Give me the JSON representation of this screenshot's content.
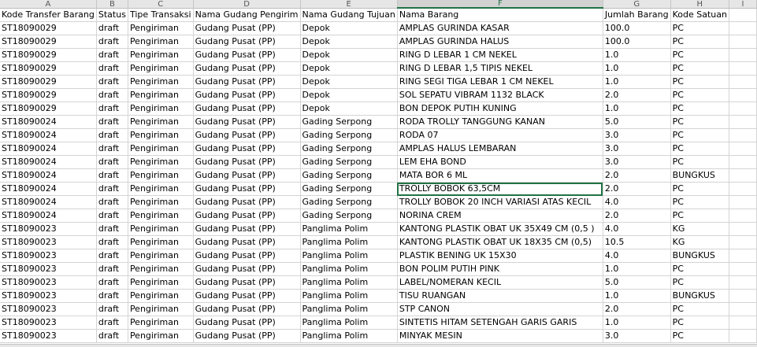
{
  "columns": [
    "A",
    "B",
    "C",
    "D",
    "E",
    "F",
    "G",
    "H",
    "I"
  ],
  "selected_column": "F",
  "headers": [
    "Kode Transfer Barang",
    "Status",
    "Tipe Transaksi",
    "Nama Gudang Pengirim",
    "Nama Gudang Tujuan",
    "Nama Barang",
    "Jumlah Barang",
    "Kode Satuan",
    ""
  ],
  "rows": [
    [
      "ST18090029",
      "draft",
      "Pengiriman",
      "Gudang Pusat (PP)",
      "Depok",
      "AMPLAS GURINDA KASAR",
      "100.0",
      "PC",
      ""
    ],
    [
      "ST18090029",
      "draft",
      "Pengiriman",
      "Gudang Pusat (PP)",
      "Depok",
      "AMPLAS GURINDA HALUS",
      "100.0",
      "PC",
      ""
    ],
    [
      "ST18090029",
      "draft",
      "Pengiriman",
      "Gudang Pusat (PP)",
      "Depok",
      "RING D LEBAR 1 CM NEKEL",
      "1.0",
      "PC",
      ""
    ],
    [
      "ST18090029",
      "draft",
      "Pengiriman",
      "Gudang Pusat (PP)",
      "Depok",
      "RING D LEBAR 1,5 TIPIS NEKEL",
      "1.0",
      "PC",
      ""
    ],
    [
      "ST18090029",
      "draft",
      "Pengiriman",
      "Gudang Pusat (PP)",
      "Depok",
      "RING SEGI TIGA LEBAR 1 CM NEKEL",
      "1.0",
      "PC",
      ""
    ],
    [
      "ST18090029",
      "draft",
      "Pengiriman",
      "Gudang Pusat (PP)",
      "Depok",
      "SOL SEPATU VIBRAM 1132 BLACK",
      "2.0",
      "PC",
      ""
    ],
    [
      "ST18090029",
      "draft",
      "Pengiriman",
      "Gudang Pusat (PP)",
      "Depok",
      "BON DEPOK PUTIH KUNING",
      "1.0",
      "PC",
      ""
    ],
    [
      "ST18090024",
      "draft",
      "Pengiriman",
      "Gudang Pusat (PP)",
      "Gading Serpong",
      "RODA TROLLY TANGGUNG KANAN",
      "5.0",
      "PC",
      ""
    ],
    [
      "ST18090024",
      "draft",
      "Pengiriman",
      "Gudang Pusat (PP)",
      "Gading Serpong",
      "RODA 07",
      "3.0",
      "PC",
      ""
    ],
    [
      "ST18090024",
      "draft",
      "Pengiriman",
      "Gudang Pusat (PP)",
      "Gading Serpong",
      "AMPLAS HALUS LEMBARAN",
      "3.0",
      "PC",
      ""
    ],
    [
      "ST18090024",
      "draft",
      "Pengiriman",
      "Gudang Pusat (PP)",
      "Gading Serpong",
      "LEM EHA BOND",
      "3.0",
      "PC",
      ""
    ],
    [
      "ST18090024",
      "draft",
      "Pengiriman",
      "Gudang Pusat (PP)",
      "Gading Serpong",
      "MATA BOR 6 ML",
      "2.0",
      "BUNGKUS",
      ""
    ],
    [
      "ST18090024",
      "draft",
      "Pengiriman",
      "Gudang Pusat (PP)",
      "Gading Serpong",
      "TROLLY BOBOK 63,5CM",
      "2.0",
      "PC",
      ""
    ],
    [
      "ST18090024",
      "draft",
      "Pengiriman",
      "Gudang Pusat (PP)",
      "Gading Serpong",
      "TROLLY BOBOK 20 INCH VARIASI ATAS KECIL",
      "4.0",
      "PC",
      ""
    ],
    [
      "ST18090024",
      "draft",
      "Pengiriman",
      "Gudang Pusat (PP)",
      "Gading Serpong",
      "NORINA CREM",
      "2.0",
      "PC",
      ""
    ],
    [
      "ST18090023",
      "draft",
      "Pengiriman",
      "Gudang Pusat (PP)",
      "Panglima Polim",
      "KANTONG PLASTIK OBAT UK 35X49 CM (0,5 )",
      "4.0",
      "KG",
      ""
    ],
    [
      "ST18090023",
      "draft",
      "Pengiriman",
      "Gudang Pusat (PP)",
      "Panglima Polim",
      "KANTONG PLASTIK OBAT UK 18X35 CM (0,5)",
      "10.5",
      "KG",
      ""
    ],
    [
      "ST18090023",
      "draft",
      "Pengiriman",
      "Gudang Pusat (PP)",
      "Panglima Polim",
      "PLASTIK BENING UK 15X30",
      "4.0",
      "BUNGKUS",
      ""
    ],
    [
      "ST18090023",
      "draft",
      "Pengiriman",
      "Gudang Pusat (PP)",
      "Panglima Polim",
      "BON POLIM PUTIH PINK",
      "1.0",
      "PC",
      ""
    ],
    [
      "ST18090023",
      "draft",
      "Pengiriman",
      "Gudang Pusat (PP)",
      "Panglima Polim",
      "LABEL/NOMERAN KECIL",
      "5.0",
      "PC",
      ""
    ],
    [
      "ST18090023",
      "draft",
      "Pengiriman",
      "Gudang Pusat (PP)",
      "Panglima Polim",
      "TISU RUANGAN",
      "1.0",
      "BUNGKUS",
      ""
    ],
    [
      "ST18090023",
      "draft",
      "Pengiriman",
      "Gudang Pusat (PP)",
      "Panglima Polim",
      "STP CANON",
      "2.0",
      "PC",
      ""
    ],
    [
      "ST18090023",
      "draft",
      "Pengiriman",
      "Gudang Pusat (PP)",
      "Panglima Polim",
      "SINTETIS HITAM SETENGAH GARIS GARIS",
      "1.0",
      "PC",
      ""
    ],
    [
      "ST18090023",
      "draft",
      "Pengiriman",
      "Gudang Pusat (PP)",
      "Panglima Polim",
      "MINYAK MESIN",
      "3.0",
      "PC",
      ""
    ]
  ],
  "selected_cell": {
    "row": 12,
    "col": 5
  }
}
